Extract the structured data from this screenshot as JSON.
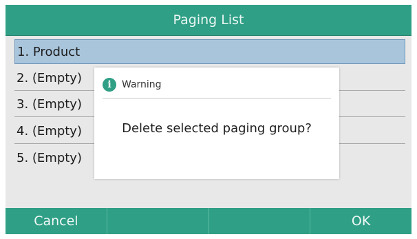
{
  "title_bar": {
    "title": "Paging List"
  },
  "list": {
    "items": [
      {
        "label": "1. Product",
        "selected": true
      },
      {
        "label": "2. (Empty)",
        "selected": false
      },
      {
        "label": "3. (Empty)",
        "selected": false
      },
      {
        "label": "4. (Empty)",
        "selected": false
      },
      {
        "label": "5. (Empty)",
        "selected": false
      }
    ]
  },
  "dialog": {
    "icon": "info-icon",
    "title": "Warning",
    "message": "Delete selected paging group?"
  },
  "softkeys": [
    {
      "label": "Cancel"
    },
    {
      "label": ""
    },
    {
      "label": ""
    },
    {
      "label": "OK"
    }
  ],
  "colors": {
    "accent": "#2f9f86",
    "selection": "#a9c5dc",
    "background": "#e8e8e8"
  }
}
